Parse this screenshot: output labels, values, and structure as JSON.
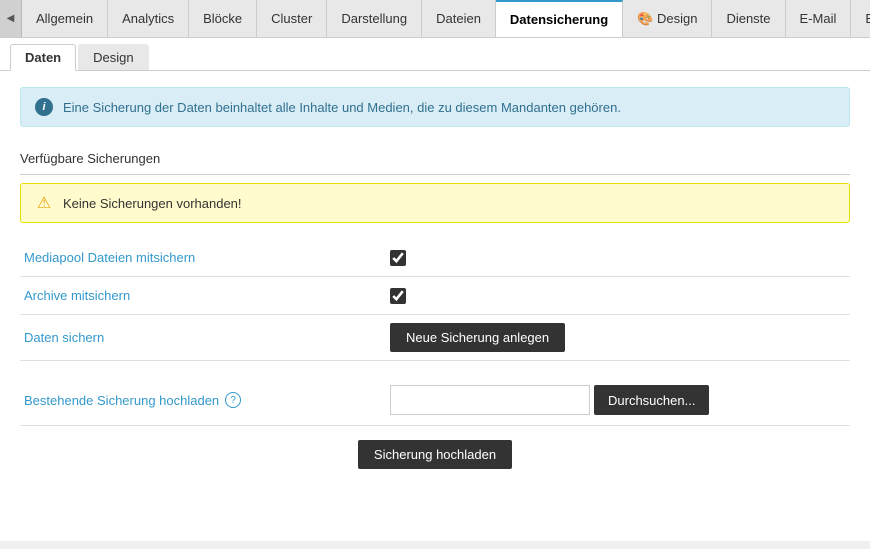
{
  "nav": {
    "arrow_label": "◀",
    "tabs": [
      {
        "id": "allgemein",
        "label": "Allgemein",
        "active": false
      },
      {
        "id": "analytics",
        "label": "Analytics",
        "active": false
      },
      {
        "id": "bloecke",
        "label": "Blöcke",
        "active": false
      },
      {
        "id": "cluster",
        "label": "Cluster",
        "active": false
      },
      {
        "id": "darstellung",
        "label": "Darstellung",
        "active": false
      },
      {
        "id": "dateien",
        "label": "Dateien",
        "active": false
      },
      {
        "id": "datensicherung",
        "label": "Datensicherung",
        "active": true
      },
      {
        "id": "design",
        "label": "🎨 Design",
        "active": false
      },
      {
        "id": "dienste",
        "label": "Dienste",
        "active": false
      },
      {
        "id": "email",
        "label": "E-Mail",
        "active": false
      },
      {
        "id": "editor",
        "label": "Editor",
        "active": false
      }
    ]
  },
  "sub_tabs": [
    {
      "id": "daten",
      "label": "Daten",
      "active": true
    },
    {
      "id": "design",
      "label": "Design",
      "active": false
    }
  ],
  "info_box": {
    "icon": "i",
    "text": "Eine Sicherung der Daten beinhaltet alle Inhalte und Medien, die zu diesem Mandanten gehören."
  },
  "section": {
    "title": "Verfügbare Sicherungen"
  },
  "warning_box": {
    "icon": "⚠",
    "text": "Keine Sicherungen vorhanden!"
  },
  "form_rows": [
    {
      "id": "mediapool",
      "label": "Mediapool Dateien mitsichern",
      "type": "checkbox",
      "checked": true
    },
    {
      "id": "archive",
      "label": "Archive mitsichern",
      "type": "checkbox",
      "checked": true
    },
    {
      "id": "daten_sichern",
      "label": "Daten sichern",
      "type": "button",
      "button_label": "Neue Sicherung anlegen"
    }
  ],
  "upload_section": {
    "label": "Bestehende Sicherung hochladen",
    "help_icon": "?",
    "file_placeholder": "",
    "browse_label": "Durchsuchen...",
    "upload_button_label": "Sicherung hochladen"
  }
}
